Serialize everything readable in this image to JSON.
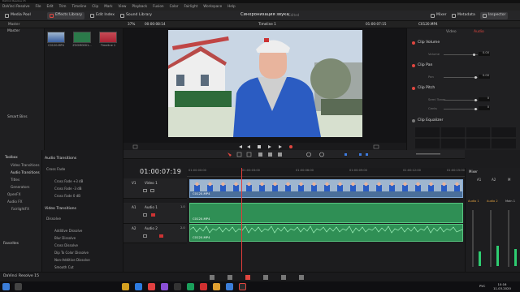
{
  "window_title": "DaVinci Resolve 15",
  "menu": [
    "DaVinci Resolve",
    "File",
    "Edit",
    "Trim",
    "Timeline",
    "Clip",
    "Mark",
    "View",
    "Playback",
    "Fusion",
    "Color",
    "Fairlight",
    "Workspace",
    "Help"
  ],
  "toolbar": {
    "media_pool": "Media Pool",
    "effects_library": "Effects Library",
    "edit_index": "Edit Index",
    "sound_library": "Sound Library",
    "project_title": "Синхронизация звука",
    "project_status": "Edited",
    "mixer": "Mixer",
    "metadata": "Metadata",
    "inspector": "Inspector"
  },
  "subbar": {
    "bin": "Master",
    "zoom": "37%",
    "timecode_left": "00:00:08:14",
    "timeline_name": "Timeline 1",
    "timecode_right": "01:00:07:15",
    "clip_name": "C0120.MP4"
  },
  "bins": {
    "master": "Master",
    "smart_bins": "Smart Bins"
  },
  "media": [
    {
      "label": "C0120.MP4"
    },
    {
      "label": "ZOOM0001..."
    },
    {
      "label": "Timeline 1"
    }
  ],
  "inspector": {
    "tab_video": "Video",
    "tab_audio": "Audio",
    "clip_volume": "Clip Volume",
    "volume_label": "Volume",
    "volume_value": "0.00",
    "clip_pan": "Clip Pan",
    "pan_label": "Pan",
    "pan_value": "0.00",
    "clip_pitch": "Clip Pitch",
    "semitones_label": "Semi Tones",
    "semitones_value": "0",
    "cents_label": "Cents",
    "cents_value": "0",
    "clip_equalizer": "Clip Equalizer"
  },
  "toolbox": {
    "title": "Toolbox",
    "items": [
      "Video Transitions",
      "Audio Transitions",
      "Titles",
      "Generators",
      "OpenFX",
      "Audio FX",
      "FairlightFX"
    ],
    "favorites": "Favorites"
  },
  "transitions": {
    "audio_header": "Audio Transitions",
    "cross_fade": "Cross Fade",
    "audio_items": [
      "Cross Fade +3 dB",
      "Cross Fade -3 dB",
      "Cross Fade 0 dB"
    ],
    "video_header": "Video Transitions",
    "dissolve": "Dissolve",
    "video_items": [
      "Additive Dissolve",
      "Blur Dissolve",
      "Cross Dissolve",
      "Dip To Color Dissolve",
      "Non-Additive Dissolve",
      "Smooth Cut"
    ]
  },
  "timeline": {
    "timecode": "01:00:07:19",
    "ruler": [
      "01:00:00:00",
      "01:00:03:00",
      "01:00:06:00",
      "01:00:09:00",
      "01:00:12:00",
      "01:00:15:00"
    ],
    "tracks": [
      {
        "id": "V1",
        "name": "Video 1",
        "clip": "C0120.MP4"
      },
      {
        "id": "A1",
        "name": "Audio 1",
        "clip": "C0120.MP4"
      },
      {
        "id": "A2",
        "name": "Audio 2",
        "clip": "C0120.MP4"
      }
    ],
    "a1_value": "1.0",
    "a2_value": "2.0"
  },
  "mixer": {
    "title": "Mixer",
    "a1": "A1",
    "a2": "A2",
    "m": "M",
    "audio1": "Audio 1",
    "audio2": "Audio 2",
    "main1": "Main 1"
  },
  "statusbar": {
    "app_name": "DaVinci Resolve 15"
  },
  "clock": {
    "time": "10:16",
    "date": "11.03.2020",
    "lang": "РУС"
  },
  "colors": {
    "accent": "#e0463f",
    "video_clip": "#4b6f9a",
    "audio_clip": "#2f8f55"
  }
}
